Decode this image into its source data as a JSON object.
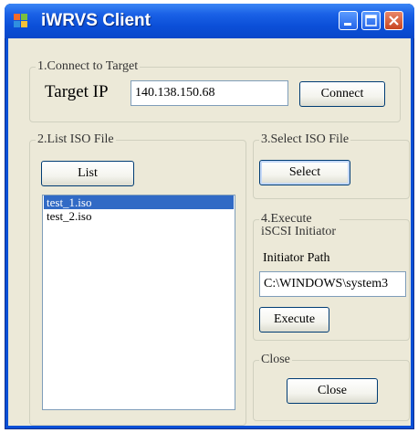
{
  "window": {
    "title": "iWRVS Client",
    "controls": [
      "minimize-icon",
      "maximize-icon",
      "close-icon"
    ]
  },
  "connect": {
    "legend": "1.Connect to Target",
    "label": "Target IP",
    "ip_value": "140.138.150.68",
    "button": "Connect"
  },
  "list_iso": {
    "legend": "2.List ISO File",
    "button": "List",
    "files": [
      {
        "name": "test_1.iso",
        "selected": true
      },
      {
        "name": "test_2.iso",
        "selected": false
      }
    ]
  },
  "select_iso": {
    "legend": "3.Select ISO File",
    "button": "Select"
  },
  "execute": {
    "legend": "4.Execute iSCSI Initiator",
    "path_label": "Initiator Path",
    "path_value": "C:\\WINDOWS\\system3",
    "button": "Execute"
  },
  "close_group": {
    "legend": "Close",
    "button": "Close"
  },
  "colors": {
    "titlebar": "#0b4fd8",
    "client_bg": "#ece9d8",
    "selection": "#316ac5"
  }
}
